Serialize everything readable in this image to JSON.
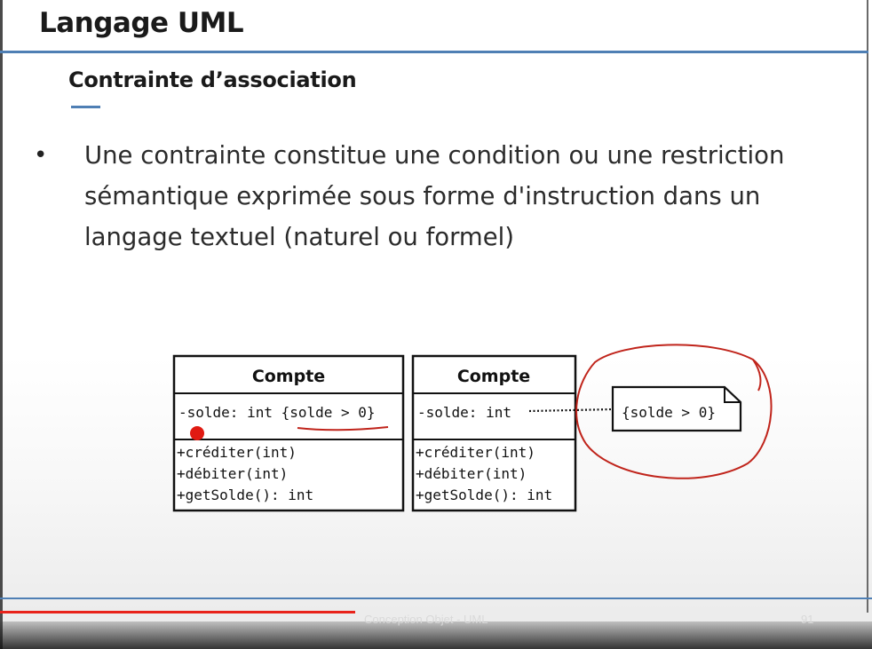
{
  "slide": {
    "title": "Langage UML",
    "subtitle": "Contrainte d’association",
    "bullet": "Une contrainte constitue une condition ou une restriction sémantique exprimée sous forme d'instruction dans un langage textuel (naturel ou formel)"
  },
  "diagram": {
    "left_class": {
      "name": "Compte",
      "attribute": "-solde: int {solde > 0}",
      "methods": [
        "+créditer(int)",
        "+débiter(int)",
        "+getSolde(): int"
      ]
    },
    "right_class": {
      "name": "Compte",
      "attribute": "-solde: int",
      "methods": [
        "+créditer(int)",
        "+débiter(int)",
        "+getSolde(): int"
      ]
    },
    "note": "{solde > 0}"
  },
  "footer": {
    "text": "Conception Objet - UML",
    "page": "91"
  },
  "colors": {
    "accent": "#4f7fb4",
    "annotation": "#c0241b",
    "progress": "#e8221a"
  }
}
